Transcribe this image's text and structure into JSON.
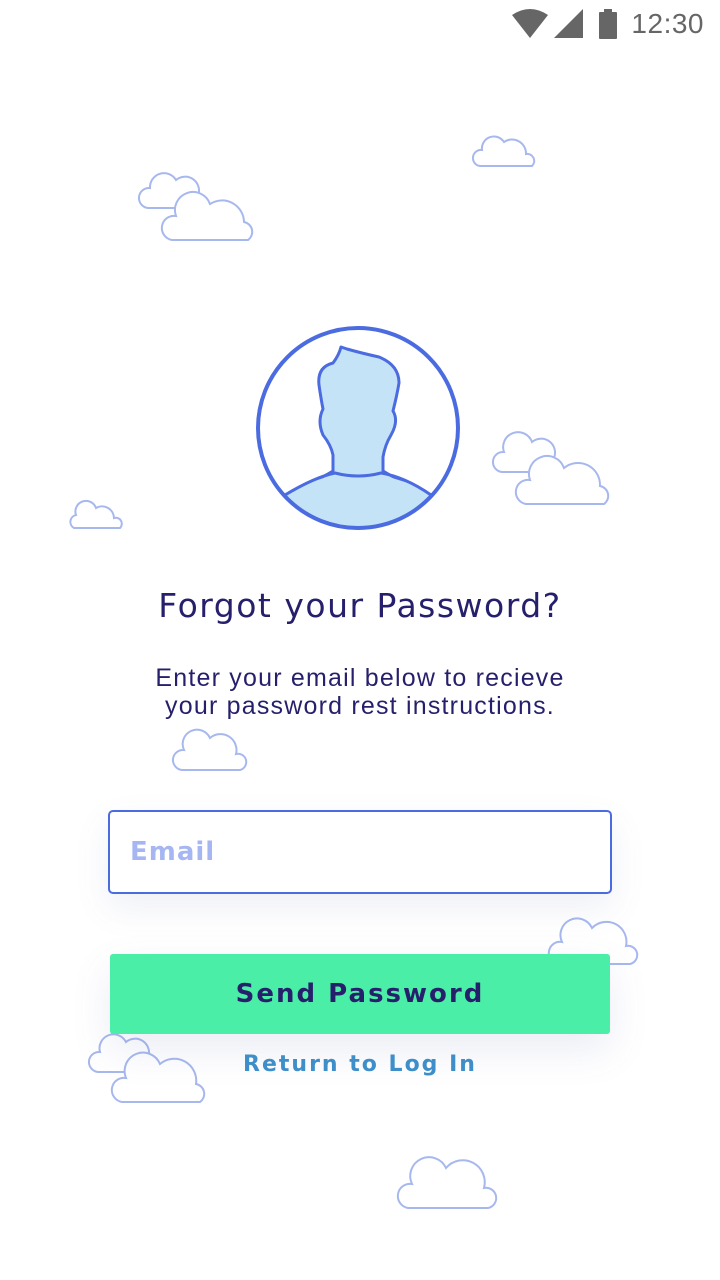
{
  "status_bar": {
    "time": "12:30",
    "icons": [
      "wifi-icon",
      "signal-icon",
      "battery-icon"
    ]
  },
  "avatar": {
    "icon": "user-silhouette-icon"
  },
  "headline": "Forgot your Password?",
  "subtext": "Enter your email below to recieve your password rest instructions.",
  "email": {
    "placeholder": "Email",
    "value": ""
  },
  "send_button": {
    "label": "Send Password"
  },
  "return_link": {
    "label": "Return to Log In"
  },
  "colors": {
    "primary_text": "#261f6b",
    "accent_blue": "#4b6be0",
    "button_green": "#4beea6",
    "link_blue": "#3d8ec9",
    "placeholder": "#a5b6f2",
    "cloud_stroke": "#a7b8ee",
    "avatar_fill": "#c5e3f7"
  }
}
